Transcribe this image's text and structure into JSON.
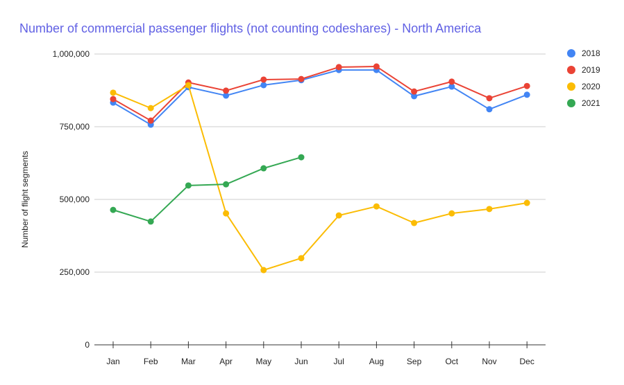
{
  "chart_data": {
    "type": "line",
    "title": "Number of commercial passenger flights (not counting codeshares) - North America",
    "xlabel": "",
    "ylabel": "Number of flight segments",
    "ylim": [
      0,
      1000000
    ],
    "yticks": [
      0,
      250000,
      500000,
      750000,
      1000000
    ],
    "ytick_labels": [
      "0",
      "250,000",
      "500,000",
      "750,000",
      "1,000,000"
    ],
    "grid": true,
    "legend_position": "right",
    "categories": [
      "Jan",
      "Feb",
      "Mar",
      "Apr",
      "May",
      "Jun",
      "Jul",
      "Aug",
      "Sep",
      "Oct",
      "Nov",
      "Dec"
    ],
    "series": [
      {
        "name": "2018",
        "color": "#4285f4",
        "values": [
          833000,
          757000,
          886000,
          857000,
          893000,
          910000,
          945000,
          945000,
          855000,
          888000,
          810000,
          860000
        ]
      },
      {
        "name": "2019",
        "color": "#ea4335",
        "values": [
          845000,
          771000,
          902000,
          874000,
          912000,
          914000,
          955000,
          957000,
          871000,
          905000,
          848000,
          890000
        ]
      },
      {
        "name": "2020",
        "color": "#fbbc04",
        "values": [
          867000,
          814000,
          893000,
          452000,
          257000,
          298000,
          445000,
          476000,
          419000,
          452000,
          467000,
          488000
        ]
      },
      {
        "name": "2021",
        "color": "#34a853",
        "values": [
          464000,
          424000,
          548000,
          552000,
          607000,
          645000
        ]
      }
    ]
  }
}
